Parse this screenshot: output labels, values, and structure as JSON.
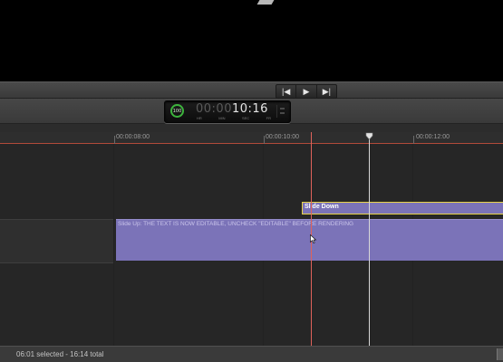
{
  "transport": {
    "prev_icon": "skip-back-icon",
    "play_icon": "play-icon",
    "next_icon": "skip-forward-icon",
    "prev_glyph": "|◀",
    "play_glyph": "▶",
    "next_glyph": "▶|"
  },
  "dashboard": {
    "meter_label": "100",
    "timecode_dim": "00:00",
    "timecode_bright": "10:16",
    "unit_hr": "HR",
    "unit_min": "MIN",
    "unit_sec": "SEC",
    "unit_fr": "FR"
  },
  "ruler": {
    "labels": [
      "00:00:08:00",
      "00:00:10:00",
      "00:00:12:00"
    ]
  },
  "clips": {
    "title_clip": "Slide Up: THE TEXT IS NOW EDITABLE, UNCHECK \"EDITABLE\" BEFORE RENDERING",
    "transition_clip": "Slide Down"
  },
  "status": {
    "selection": "06:01 selected - 16:14 total"
  },
  "colors": {
    "clip_purple": "#7b73b8",
    "selection_yellow": "#e8d34a",
    "skimmer_red": "#e0625a",
    "meter_green": "#3db43d"
  }
}
